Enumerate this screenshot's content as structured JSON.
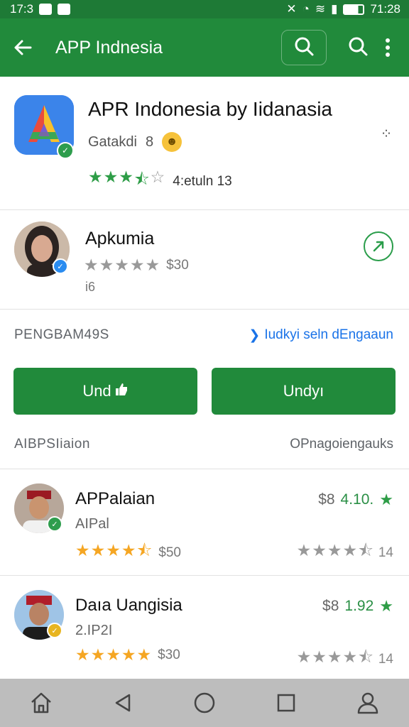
{
  "status_bar": {
    "time_left": "17:3",
    "time_right": "71:28"
  },
  "app_bar": {
    "title": "APP Indnesia",
    "back_icon": "back-arrow-icon",
    "search_box_icon": "search-icon",
    "search_icon": "search-icon",
    "more_icon": "more-vert-icon"
  },
  "app": {
    "name": "APR Indonesia by Iidanasia",
    "developer": "Gatakdi",
    "developer_suffix": "8",
    "rating_stars": 3.5,
    "rating_text": "4:etuln 13",
    "colors": {
      "primary": "#218a3b",
      "star_green": "#2e9d47",
      "star_orange": "#f5a623"
    }
  },
  "developer_block": {
    "name": "Apkumia",
    "rating_stars": 5,
    "price": "$30",
    "sub": "i6"
  },
  "section_one": {
    "title": "PENGBAM49S",
    "link": "Iudkyi seln dEngaaun"
  },
  "buttons": {
    "left": "Und",
    "right": "Undyı"
  },
  "section_two": {
    "title": "AIBPSIiaion",
    "link": "OPnagoiengauks"
  },
  "list": [
    {
      "name": "APPalaian",
      "sub": "AIPal",
      "price_prefix": "$8",
      "price": "4.10.",
      "rating_left": "$50",
      "rating_right": "14",
      "badge_color": "#2e9d4d"
    },
    {
      "name": "Daıa Uangisia",
      "sub": "2.IP2I",
      "price_prefix": "$8",
      "price": "1.92",
      "rating_left": "$30",
      "rating_right": "14",
      "badge_color": "#e8b520"
    }
  ],
  "nav": {
    "home_icon": "home-icon",
    "back_icon": "back-triangle-icon",
    "circle_icon": "home-circle-icon",
    "recent_icon": "recents-square-icon",
    "profile_icon": "person-icon"
  }
}
